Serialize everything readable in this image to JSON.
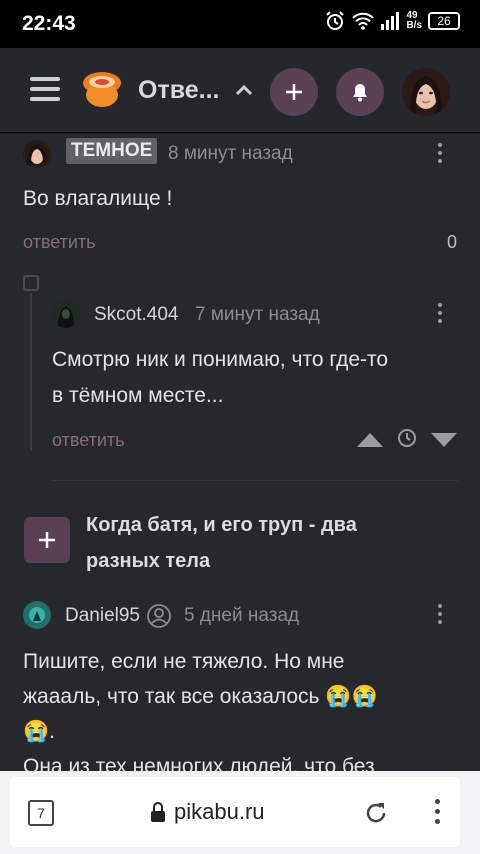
{
  "status_bar": {
    "time": "22:43",
    "net_speed_value": "49",
    "net_speed_unit": "B/s",
    "battery": "26"
  },
  "header": {
    "title": "Отве..."
  },
  "comments": [
    {
      "username_tag": "ТЕМНОЕ",
      "time": "8 минут назад",
      "text": "Во влагалище !",
      "reply_label": "ответить",
      "score": "0"
    },
    {
      "username": "Skcot.404",
      "time": "7 минут назад",
      "text_line1": "Смотрю ник и понимаю, что где-то",
      "text_line2": "в тёмном месте...",
      "reply_label": "ответить"
    },
    {
      "username": "Daniel95",
      "time": "5 дней назад",
      "text_line1": "Пишите, если не тяжело. Но мне",
      "text_line2": "жаааль, что так все оказалось 😭😭",
      "text_line3": "😭.",
      "text_line4": "Она из тех немногих людей, что без"
    }
  ],
  "post": {
    "title_line1": "Когда батя, и его труп - два",
    "title_line2": "разных тела"
  },
  "browser": {
    "tabs_count": "7",
    "url": "pikabu.ru"
  },
  "colors": {
    "accent": "#5a4054",
    "background": "#25282c",
    "header_bg": "#24272b",
    "reply_link": "#8b6a82"
  }
}
